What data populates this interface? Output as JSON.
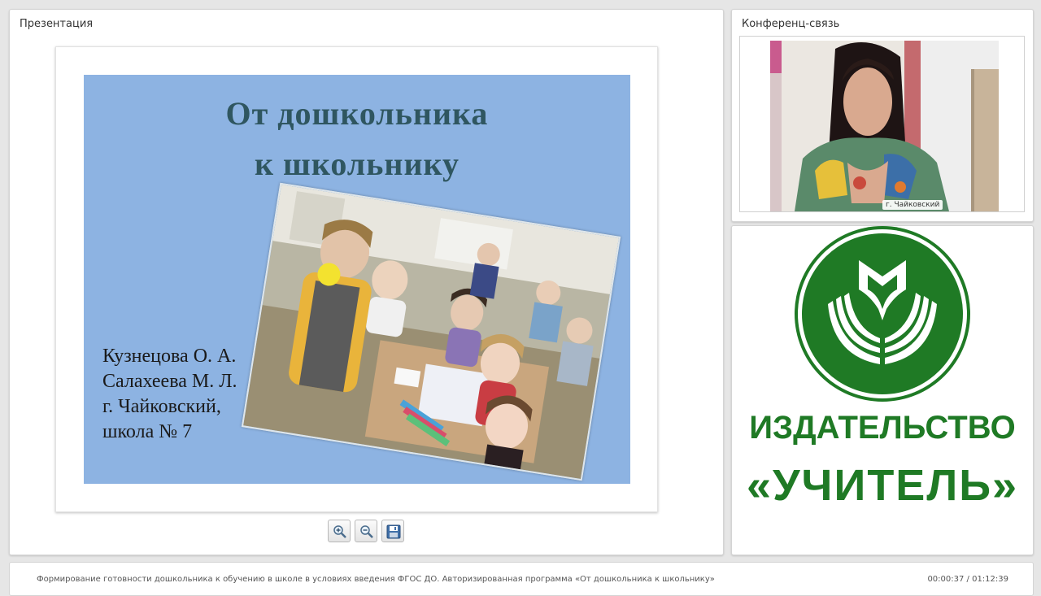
{
  "presentation": {
    "panel_title": "Презентация",
    "slide": {
      "title_line1": "От дошкольника",
      "title_line2": "к школьнику",
      "authors": [
        "Кузнецова О. А.",
        "Салахеева М. Л.",
        "г. Чайковский,",
        "школа № 7"
      ],
      "background_color": "#8db3e2"
    },
    "toolbar": {
      "buttons": [
        {
          "name": "zoom-in",
          "icon": "zoom-in-icon"
        },
        {
          "name": "zoom-out",
          "icon": "zoom-out-icon"
        },
        {
          "name": "save",
          "icon": "save-icon"
        }
      ]
    }
  },
  "conference": {
    "panel_title": "Конференц-связь",
    "video_label": "г. Чайковский"
  },
  "publisher_logo": {
    "line1": "ИЗДАТЕЛЬСТВО",
    "line2": "«УЧИТЕЛЬ»",
    "color": "#1f7a25"
  },
  "footer": {
    "title": "Формирование готовности дошкольника к обучению в школе в условиях введения ФГОС ДО. Авторизированная программа «От дошкольника к школьнику»",
    "time": "00:00:37 / 01:12:39"
  }
}
